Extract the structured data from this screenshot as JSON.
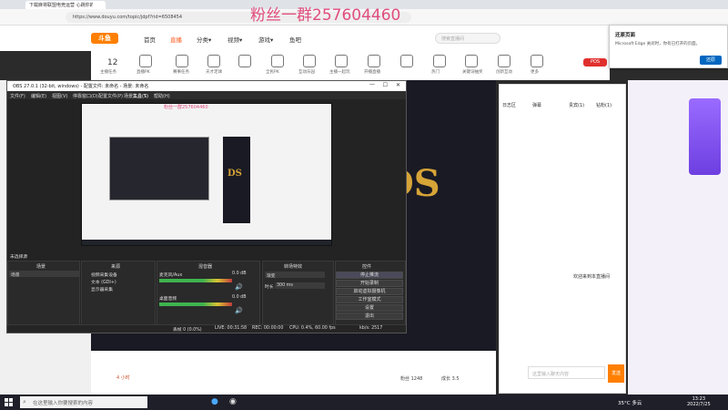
{
  "browser": {
    "tab_title": "下载麻将联盟电竞运营 心跳你的",
    "url": "https://www.douyu.com/topic/jdpf?rid=6508454",
    "overlay_watermark": "粉丝一群257604460"
  },
  "douyu": {
    "logo": "斗鱼",
    "nav": [
      "首页",
      "直播",
      "分类▾",
      "视频▾",
      "游戏▾",
      "鱼吧"
    ],
    "search_placeholder": "搜索直播间",
    "toolbar": [
      "主播任务",
      "直播PK",
      "赛事任务",
      "天才足球",
      "全民PK",
      "互动乐园",
      "主播一起玩",
      "开播直播",
      "小飞腿分段游戏",
      "热门",
      "关键词抽奖",
      "创新互动",
      "更多"
    ],
    "hot_count": "12",
    "game_logo": "DS",
    "chat_tabs": [
      "日志区",
      "弹幕",
      "贵宾(1)",
      "钻粉(1)"
    ],
    "chat_welcome": "欢迎来到本直播间",
    "chat_input_placeholder": "这里输入聊天内容",
    "send_label": "发送",
    "badge": "POS",
    "gift_bar_text": "4 小时",
    "online_label": "粉丝 1248",
    "level_label": "成长 3.5"
  },
  "toast": {
    "title": "还原页面",
    "body": "Microsoft Edge 关闭时，你有已打开的页面。",
    "button": "还原"
  },
  "obs": {
    "title": "OBS 27.0.1 (32-bit, windows) - 配置文件: 未命名 - 场景: 未命名",
    "menu": [
      "文件(F)",
      "编辑(E)",
      "视图(V)",
      "停靠窗口(D)",
      "配置文件(P)",
      "场景集合(S)",
      "工具(T)",
      "帮助(H)"
    ],
    "preview_text": "粉丝一群257604460",
    "preview_logo": "DS",
    "no_source": "未选择源",
    "docks": {
      "scenes": {
        "header": "场景",
        "items": [
          "场景"
        ]
      },
      "sources": {
        "header": "来源",
        "items": [
          "视频采集设备",
          "文本 (GDI+)",
          "显示器采集"
        ]
      },
      "mixer": {
        "header": "混音器",
        "tracks": [
          {
            "name": "麦克风/Aux",
            "db": "0.0 dB"
          },
          {
            "name": "桌面音频",
            "db": "0.0 dB"
          }
        ]
      },
      "transitions": {
        "header": "转场特效",
        "type": "渐变",
        "duration_label": "时长",
        "duration": "300 ms"
      },
      "controls": {
        "header": "控件",
        "buttons": [
          "停止推流",
          "开始录制",
          "启动虚拟摄像机",
          "工作室模式",
          "设置",
          "退出"
        ]
      }
    },
    "status": {
      "frames": "丢帧 0 (0.0%)",
      "live": "LIVE: 00:31:58",
      "rec": "REC: 00:00:00",
      "cpu": "CPU: 0.4%, 60.00 fps",
      "kbps": "kb/s: 2517"
    }
  },
  "taskbar": {
    "search_placeholder": "在这里输入你要搜索的内容",
    "weather": "35°C 多云",
    "time": "13:23",
    "date": "2022/7/25"
  }
}
